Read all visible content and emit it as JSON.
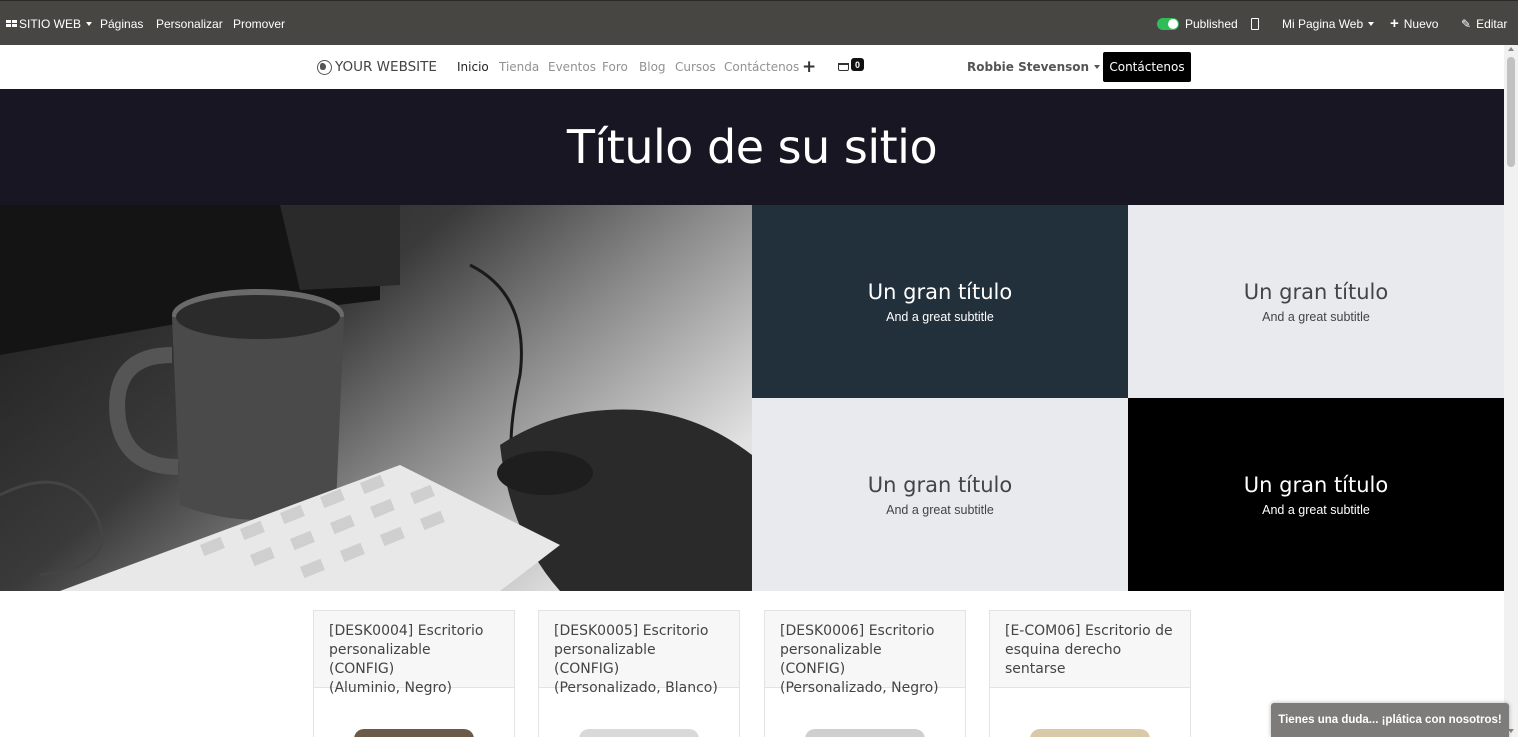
{
  "adminbar": {
    "apps_label": "SITIO WEB",
    "pages": "Páginas",
    "customize": "Personalizar",
    "promote": "Promover",
    "published": "Published",
    "website_selector": "Mi Pagina Web",
    "new": "Nuevo",
    "edit": "Editar"
  },
  "navbar": {
    "logo": "YOUR WEBSITE",
    "items": [
      "Inicio",
      "Tienda",
      "Eventos",
      "Foro",
      "Blog",
      "Cursos",
      "Contáctenos"
    ],
    "active": "Inicio",
    "cart_count": "0",
    "user": "Robbie Stevenson",
    "cta": "Contáctenos"
  },
  "hero": {
    "title": "Título de su sitio"
  },
  "blocks": [
    {
      "title": "Un gran título",
      "subtitle": "And a great subtitle",
      "bg": "#22303c",
      "fg": "#ffffff"
    },
    {
      "title": "Un gran título",
      "subtitle": "And a great subtitle",
      "bg": "#e8eaed",
      "fg": "#444444"
    },
    {
      "title": "Un gran título",
      "subtitle": "And a great subtitle",
      "bg": "#e8eaed",
      "fg": "#444444"
    },
    {
      "title": "Un gran título",
      "subtitle": "And a great subtitle",
      "bg": "#000000",
      "fg": "#ffffff"
    }
  ],
  "products": [
    {
      "line1": "[DESK0004] Escritorio",
      "line2": "personalizable (CONFIG)",
      "line3": "(Aluminio, Negro)"
    },
    {
      "line1": "[DESK0005] Escritorio",
      "line2": "personalizable (CONFIG)",
      "line3": "(Personalizado, Blanco)"
    },
    {
      "line1": "[DESK0006] Escritorio",
      "line2": "personalizable (CONFIG)",
      "line3": "(Personalizado, Negro)"
    },
    {
      "line1": "[E-COM06] Escritorio de",
      "line2": "esquina derecho",
      "line3": "sentarse"
    }
  ],
  "chat": {
    "label": "Tienes una duda... ¡plática con nosotros!"
  },
  "colors": {
    "adminbar": "#484643",
    "hero": "#191624",
    "toggle_on": "#2ebd59",
    "accent_button": "#000000"
  }
}
